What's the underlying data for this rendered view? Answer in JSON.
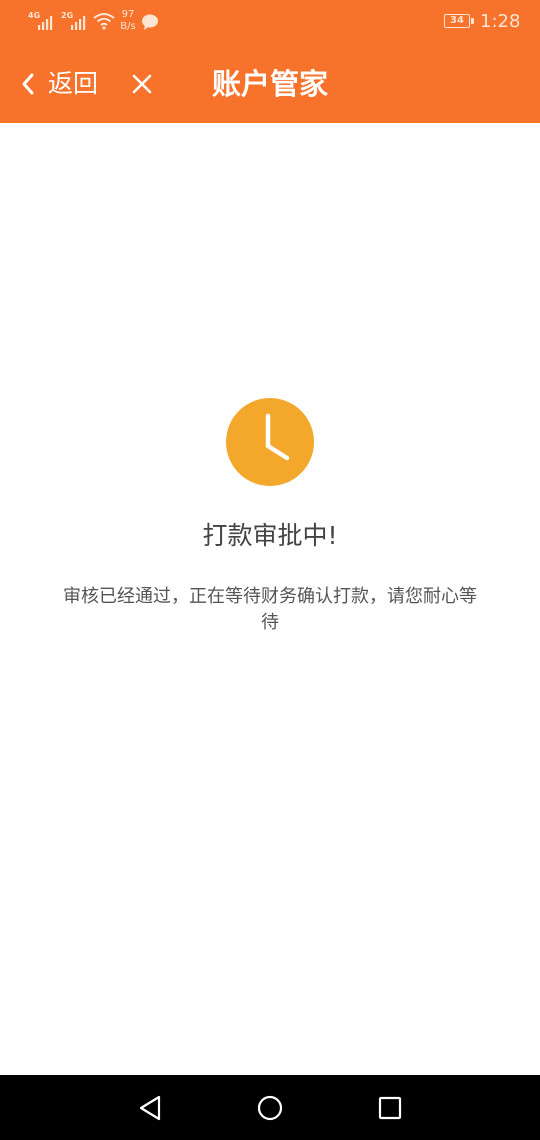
{
  "status_bar": {
    "sim1_network": "4G",
    "sim2_network": "2G",
    "net_speed_value": "97",
    "net_speed_unit": "B/s",
    "battery_level": "34",
    "time": "1:28",
    "icons": [
      "signal-icon",
      "wifi-icon",
      "chat-bubble-icon",
      "battery-icon"
    ]
  },
  "header": {
    "back_label": "返回",
    "title": "账户管家",
    "icons": [
      "chevron-left-icon",
      "close-icon"
    ]
  },
  "main": {
    "status_icon": "clock-icon",
    "status_title": "打款审批中!",
    "status_description": "审核已经通过，正在等待财务确认打款，请您耐心等待"
  },
  "nav_bar": {
    "icons": [
      "back-triangle-icon",
      "home-circle-icon",
      "recents-square-icon"
    ]
  },
  "colors": {
    "brand": "#f7722b",
    "clock_badge": "#f3a72b",
    "nav_bar": "#000000"
  }
}
